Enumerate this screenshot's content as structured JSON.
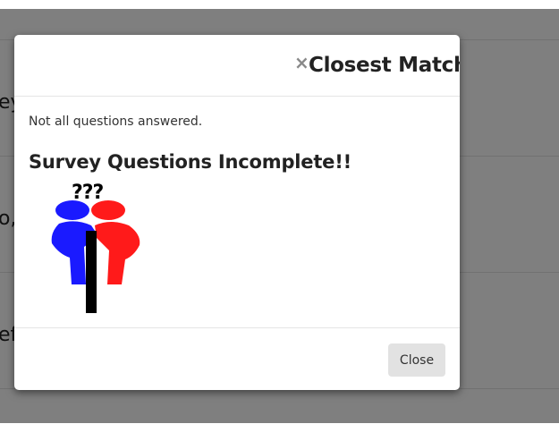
{
  "background": {
    "row_fragments": [
      "ey",
      "o,",
      "ef"
    ]
  },
  "modal": {
    "close_icon": "×",
    "title": "Closest Match",
    "message": "Not all questions answered.",
    "heading": "Survey Questions Incomplete!!",
    "illustration": {
      "name": "confused-people-illustration",
      "marks": "???",
      "colors": {
        "left_person": "#1a1aff",
        "right_person": "#ff1a1a",
        "pole": "#000000"
      }
    },
    "footer": {
      "close_label": "Close"
    }
  }
}
